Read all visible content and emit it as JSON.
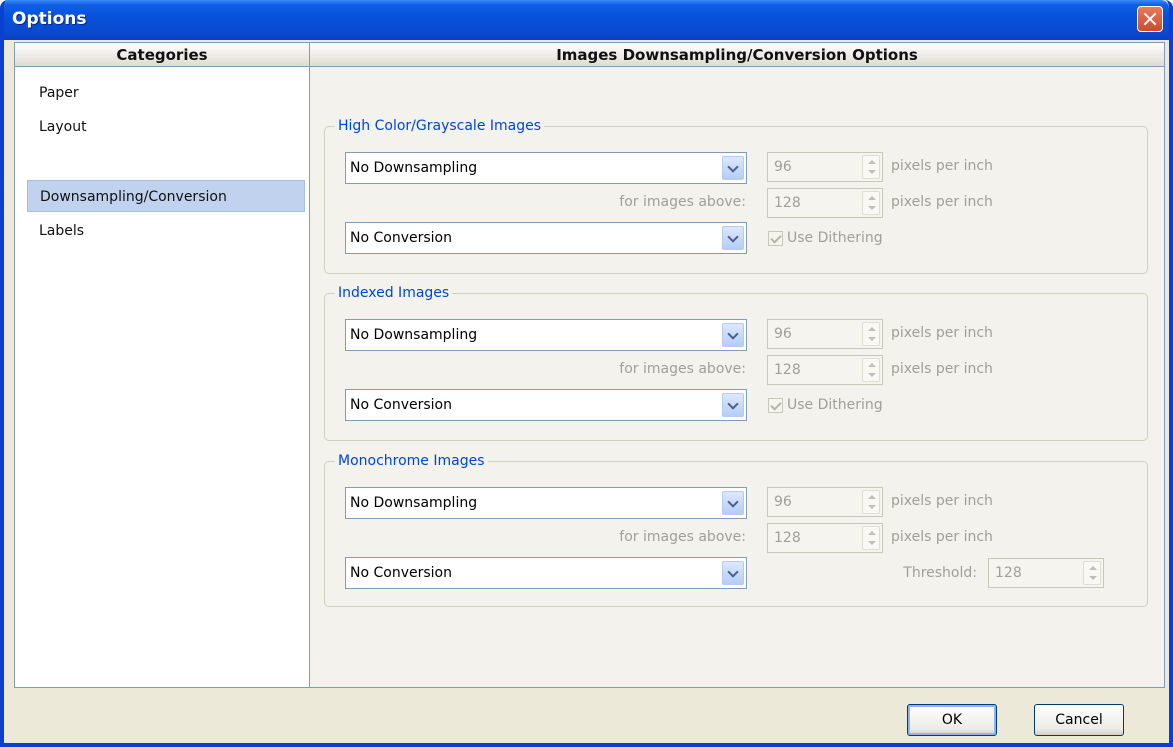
{
  "window": {
    "title": "Options"
  },
  "left_header": "Categories",
  "right_header": "Images Downsampling/Conversion Options",
  "categories": [
    {
      "label": "Paper"
    },
    {
      "label": "Layout"
    },
    {
      "label": "Downsampling/Conversion",
      "selected": true
    },
    {
      "label": "Labels"
    }
  ],
  "groups": {
    "high_color": {
      "title": "High Color/Grayscale Images",
      "downsampling": "No Downsampling",
      "resolution": "96",
      "resolution_unit": "pixels per inch",
      "above_label": "for images above:",
      "above_value": "128",
      "above_unit": "pixels per inch",
      "conversion": "No Conversion",
      "dithering_label": "Use Dithering",
      "dithering_checked": true
    },
    "indexed": {
      "title": "Indexed Images",
      "downsampling": "No Downsampling",
      "resolution": "96",
      "resolution_unit": "pixels per inch",
      "above_label": "for images above:",
      "above_value": "128",
      "above_unit": "pixels per inch",
      "conversion": "No Conversion",
      "dithering_label": "Use Dithering",
      "dithering_checked": true
    },
    "monochrome": {
      "title": "Monochrome Images",
      "downsampling": "No Downsampling",
      "resolution": "96",
      "resolution_unit": "pixels per inch",
      "above_label": "for images above:",
      "above_value": "128",
      "above_unit": "pixels per inch",
      "conversion": "No Conversion",
      "threshold_label": "Threshold:",
      "threshold_value": "128"
    }
  },
  "buttons": {
    "ok": "OK",
    "cancel": "Cancel"
  },
  "colors": {
    "titlebar": "#0551d8",
    "group_title": "#0046d5",
    "selection": "#c1d2ee"
  }
}
